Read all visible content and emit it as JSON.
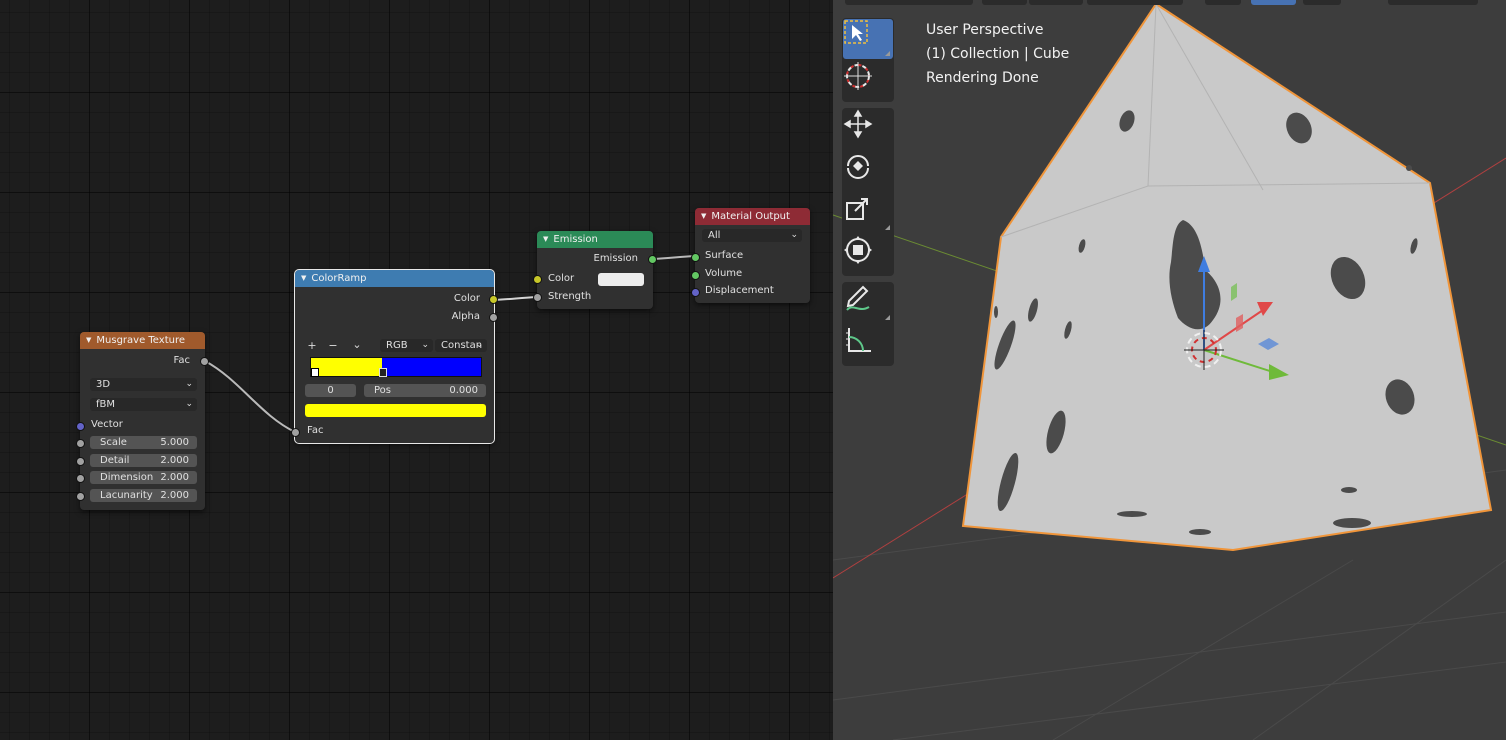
{
  "node_editor": {
    "nodes": {
      "musgrave": {
        "title": "Musgrave Texture",
        "header_color": "#a05a2c",
        "output_fac": "Fac",
        "dimensions_select": "3D",
        "type_select": "fBM",
        "input_vector": "Vector",
        "fields": [
          {
            "label": "Scale",
            "value": "5.000"
          },
          {
            "label": "Detail",
            "value": "2.000"
          },
          {
            "label": "Dimension",
            "value": "2.000"
          },
          {
            "label": "Lacunarity",
            "value": "2.000"
          }
        ]
      },
      "colorramp": {
        "title": "ColorRamp",
        "header_color": "#3e7cb1",
        "output_color": "Color",
        "output_alpha": "Alpha",
        "add_icon": "+",
        "remove_icon": "−",
        "menu_icon": "⌄",
        "color_mode": "RGB",
        "interpolation": "Constan",
        "stop_index": "0",
        "pos_label": "Pos",
        "pos_value": "0.000",
        "ramp_colors": [
          "#ffff00",
          "#0000ff"
        ],
        "stop_positions": [
          0.0,
          0.42
        ],
        "active_color": "#ffff00",
        "input_fac": "Fac"
      },
      "emission": {
        "title": "Emission",
        "header_color": "#2b8a57",
        "output_emission": "Emission",
        "input_color": "Color",
        "input_color_swatch": "#ececec",
        "input_strength": "Strength"
      },
      "material_output": {
        "title": "Material Output",
        "header_color": "#8e2b35",
        "target_select": "All",
        "input_surface": "Surface",
        "input_volume": "Volume",
        "input_displacement": "Displacement"
      }
    }
  },
  "viewport": {
    "overlay": {
      "perspective": "User Perspective",
      "collection": "(1) Collection | Cube",
      "status": "Rendering Done"
    },
    "tools": [
      {
        "name": "select-box-icon",
        "active": true
      },
      {
        "name": "cursor-icon",
        "active": false
      },
      {
        "name": "move-icon",
        "active": false
      },
      {
        "name": "rotate-icon",
        "active": false
      },
      {
        "name": "scale-icon",
        "active": false
      },
      {
        "name": "transform-icon",
        "active": false
      },
      {
        "name": "annotate-icon",
        "active": false
      },
      {
        "name": "measure-icon",
        "active": false
      }
    ],
    "colors": {
      "background": "#3d3d3d",
      "cube_face": "#c9c9c9",
      "selection_outline": "#f0953a",
      "spots": "#4b4b4b",
      "x_axis": "#c04545",
      "y_axis": "#7fa33a"
    }
  }
}
